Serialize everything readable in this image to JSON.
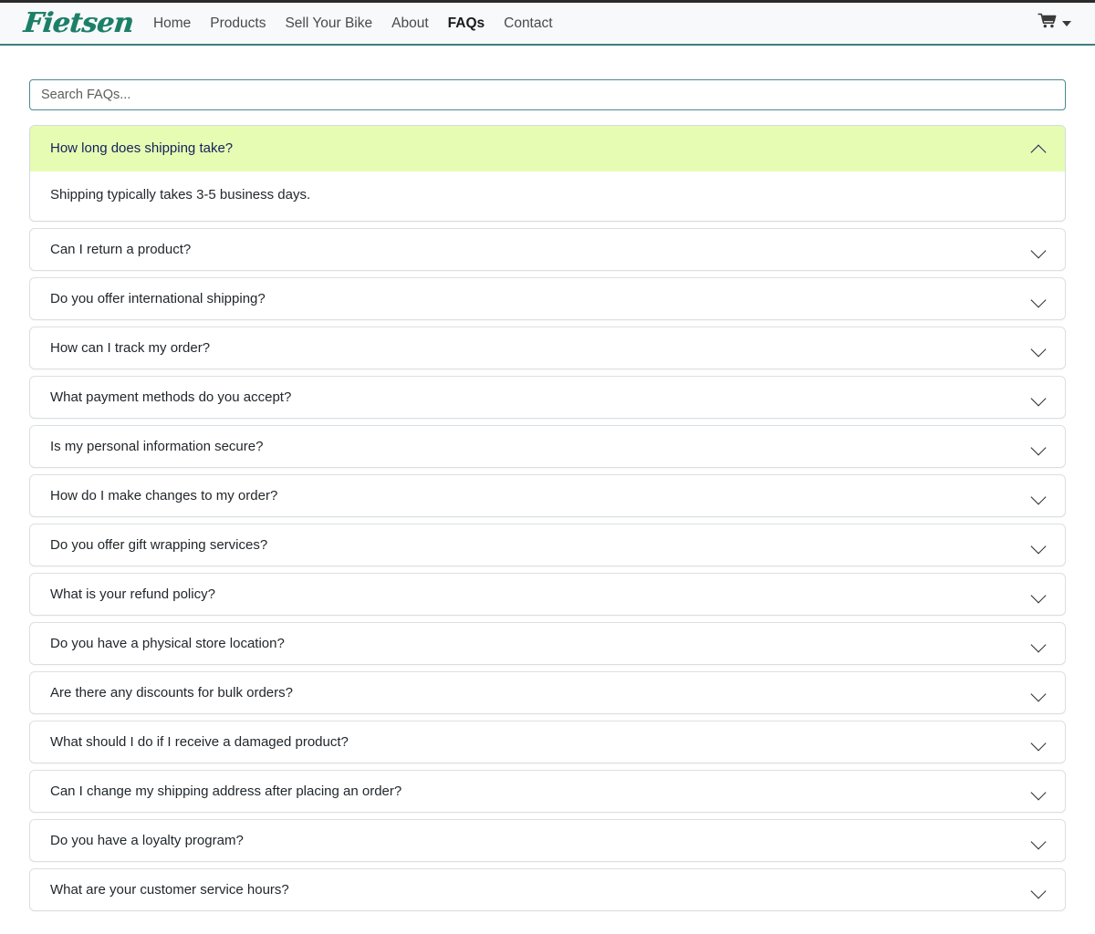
{
  "header": {
    "brand": "Fietsen",
    "nav": [
      {
        "label": "Home",
        "active": false
      },
      {
        "label": "Products",
        "active": false
      },
      {
        "label": "Sell Your Bike",
        "active": false
      },
      {
        "label": "About",
        "active": false
      },
      {
        "label": "FAQs",
        "active": true
      },
      {
        "label": "Contact",
        "active": false
      }
    ],
    "cart_icon": "shopping-cart-icon",
    "cart_caret_icon": "caret-down-icon",
    "accent_color": "#1c8069",
    "border_color": "#3c7f83",
    "background": "#f8f9fa"
  },
  "search": {
    "placeholder": "Search FAQs...",
    "value": "",
    "border_color": "#4a8b8d"
  },
  "faq": {
    "open_background": "#e6fcb3",
    "open_text_color": "#13215c",
    "expand_icon": "chevron-down-icon",
    "collapse_icon": "chevron-up-icon",
    "items": [
      {
        "question": "How long does shipping take?",
        "answer": "Shipping typically takes 3-5 business days.",
        "expanded": true
      },
      {
        "question": "Can I return a product?",
        "answer": "",
        "expanded": false
      },
      {
        "question": "Do you offer international shipping?",
        "answer": "",
        "expanded": false
      },
      {
        "question": "How can I track my order?",
        "answer": "",
        "expanded": false
      },
      {
        "question": "What payment methods do you accept?",
        "answer": "",
        "expanded": false
      },
      {
        "question": "Is my personal information secure?",
        "answer": "",
        "expanded": false
      },
      {
        "question": "How do I make changes to my order?",
        "answer": "",
        "expanded": false
      },
      {
        "question": "Do you offer gift wrapping services?",
        "answer": "",
        "expanded": false
      },
      {
        "question": "What is your refund policy?",
        "answer": "",
        "expanded": false
      },
      {
        "question": "Do you have a physical store location?",
        "answer": "",
        "expanded": false
      },
      {
        "question": "Are there any discounts for bulk orders?",
        "answer": "",
        "expanded": false
      },
      {
        "question": "What should I do if I receive a damaged product?",
        "answer": "",
        "expanded": false
      },
      {
        "question": "Can I change my shipping address after placing an order?",
        "answer": "",
        "expanded": false
      },
      {
        "question": "Do you have a loyalty program?",
        "answer": "",
        "expanded": false
      },
      {
        "question": "What are your customer service hours?",
        "answer": "",
        "expanded": false
      }
    ]
  }
}
